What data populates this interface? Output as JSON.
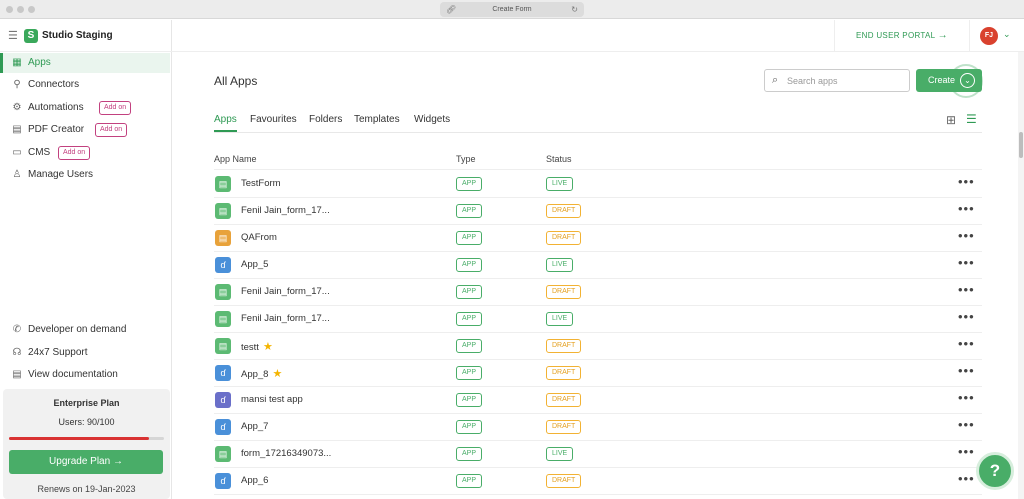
{
  "browser": {
    "url_title": "Create Form"
  },
  "sidebar": {
    "brand": "Studio Staging",
    "nav": [
      {
        "label": "Apps",
        "icon": "apps-icon",
        "glyph": "▦",
        "active": true
      },
      {
        "label": "Connectors",
        "icon": "connector-icon",
        "glyph": "⚲"
      },
      {
        "label": "Automations",
        "icon": "automation-icon",
        "glyph": "⚙",
        "badge": "Add on"
      },
      {
        "label": "PDF Creator",
        "icon": "pdf-icon",
        "glyph": "▤",
        "badge": "Add on"
      },
      {
        "label": "CMS",
        "icon": "cms-icon",
        "glyph": "▭",
        "badge": "Add on"
      },
      {
        "label": "Manage Users",
        "icon": "user-icon",
        "glyph": "♙"
      }
    ],
    "bottom_links": [
      {
        "label": "Developer on demand",
        "icon": "phone-icon",
        "glyph": "✆"
      },
      {
        "label": "24x7 Support",
        "icon": "headset-icon",
        "glyph": "☊"
      },
      {
        "label": "View documentation",
        "icon": "doc-icon",
        "glyph": "▤"
      }
    ],
    "plan": {
      "title": "Enterprise Plan",
      "users": "Users: 90/100",
      "usage_fraction": 0.9,
      "upgrade_label": "Upgrade Plan",
      "renews": "Renews on 19-Jan-2023"
    }
  },
  "header": {
    "portal_label": "END USER PORTAL",
    "avatar_initials": "FJ"
  },
  "main": {
    "title": "All Apps",
    "search_placeholder": "Search apps",
    "create_label": "Create",
    "tabs": [
      "Apps",
      "Favourites",
      "Folders",
      "Templates",
      "Widgets"
    ],
    "active_tab": "Apps",
    "columns": {
      "name": "App Name",
      "type": "Type",
      "status": "Status"
    },
    "rows": [
      {
        "name": "TestForm",
        "icon": "form-icon",
        "icon_color": "#5cba73",
        "type": "APP",
        "status": "LIVE"
      },
      {
        "name": "Fenil Jain_form_17...",
        "icon": "form-icon",
        "icon_color": "#5cba73",
        "type": "APP",
        "status": "DRAFT"
      },
      {
        "name": "QAFrom",
        "icon": "form-icon",
        "icon_color": "#e8a23a",
        "type": "APP",
        "status": "DRAFT"
      },
      {
        "name": "App_5",
        "icon": "app-icon",
        "icon_color": "#4a90d9",
        "type": "APP",
        "status": "LIVE"
      },
      {
        "name": "Fenil Jain_form_17...",
        "icon": "form-icon",
        "icon_color": "#5cba73",
        "type": "APP",
        "status": "DRAFT"
      },
      {
        "name": "Fenil Jain_form_17...",
        "icon": "form-icon",
        "icon_color": "#5cba73",
        "type": "APP",
        "status": "LIVE"
      },
      {
        "name": "testt",
        "icon": "form-icon",
        "icon_color": "#5cba73",
        "type": "APP",
        "status": "DRAFT",
        "favourite": true
      },
      {
        "name": "App_8",
        "icon": "app-icon",
        "icon_color": "#4a90d9",
        "type": "APP",
        "status": "DRAFT",
        "favourite": true
      },
      {
        "name": "mansi test app",
        "icon": "app-icon",
        "icon_color": "#6a6fc9",
        "type": "APP",
        "status": "DRAFT"
      },
      {
        "name": "App_7",
        "icon": "app-icon",
        "icon_color": "#4a90d9",
        "type": "APP",
        "status": "DRAFT"
      },
      {
        "name": "form_17216349073...",
        "icon": "form-icon",
        "icon_color": "#5cba73",
        "type": "APP",
        "status": "LIVE"
      },
      {
        "name": "App_6",
        "icon": "app-icon",
        "icon_color": "#4a90d9",
        "type": "APP",
        "status": "DRAFT"
      }
    ]
  },
  "help": {
    "label": "?"
  }
}
